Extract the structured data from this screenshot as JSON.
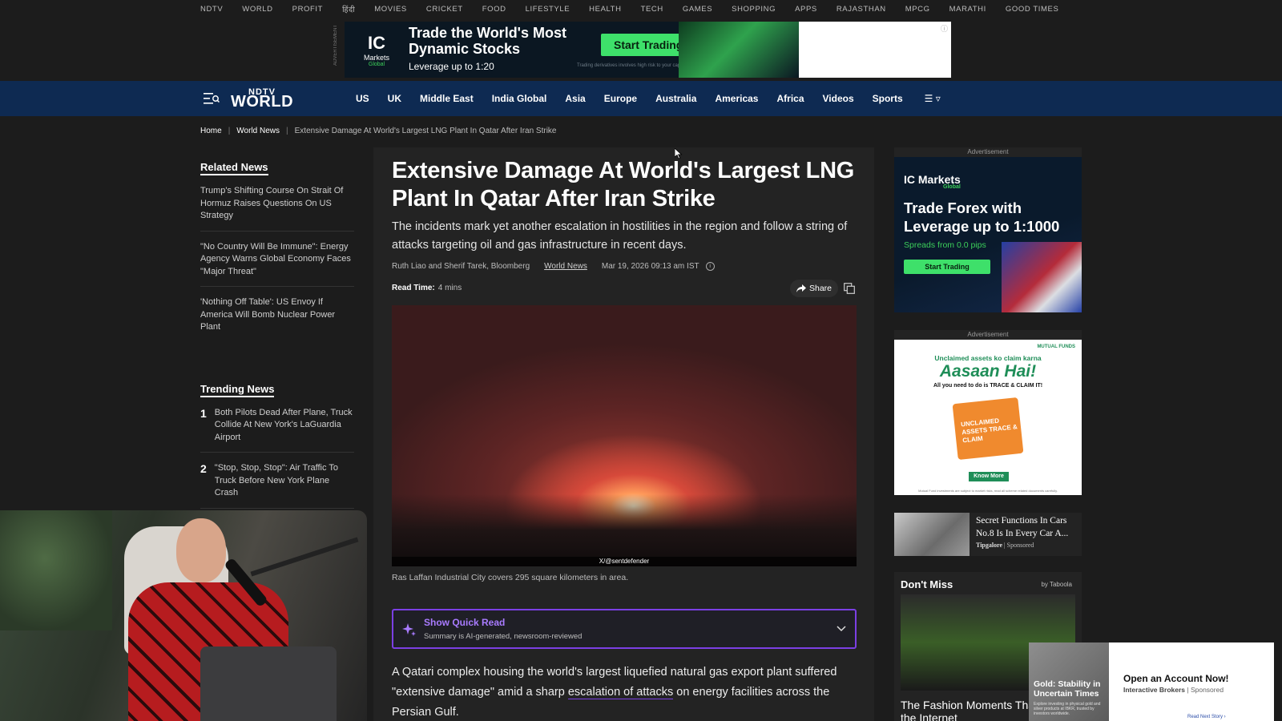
{
  "topbar": {
    "items": [
      "NDTV",
      "WORLD",
      "PROFIT",
      "हिंदी",
      "MOVIES",
      "CRICKET",
      "FOOD",
      "LIFESTYLE",
      "HEALTH",
      "TECH",
      "GAMES",
      "SHOPPING",
      "APPS",
      "RAJASTHAN",
      "MPCG",
      "MARATHI",
      "GOOD TIMES"
    ]
  },
  "top_ad": {
    "label": "ADVERTISEMENT",
    "brand": "IC",
    "brand_sub": "Markets",
    "brand_tag": "Global",
    "headline": "Trade the World's Most Dynamic Stocks",
    "sub": "Leverage up to 1:20",
    "cta": "Start Trading",
    "fine_print": "Trading derivatives involves high risk to your capital"
  },
  "nav": {
    "brand_top": "NDTV",
    "brand_main": "WORLD",
    "links": [
      "US",
      "UK",
      "Middle East",
      "India Global",
      "Asia",
      "Europe",
      "Australia",
      "Americas",
      "Africa",
      "Videos",
      "Sports"
    ],
    "more": "☰ ▿"
  },
  "breadcrumb": {
    "home": "Home",
    "section": "World News",
    "current": "Extensive Damage At World's Largest LNG Plant In Qatar After Iran Strike"
  },
  "related": {
    "title": "Related News",
    "items": [
      "Trump's Shifting Course On Strait Of Hormuz Raises Questions On US Strategy",
      "\"No Country Will Be Immune\": Energy Agency Warns Global Economy Faces \"Major Threat\"",
      "'Nothing Off Table': US Envoy If America Will Bomb Nuclear Power Plant"
    ]
  },
  "trending": {
    "title": "Trending News",
    "items": [
      {
        "num": "1",
        "text": "Both Pilots Dead After Plane, Truck Collide At New York's LaGuardia Airport"
      },
      {
        "num": "2",
        "text": "\"Stop, Stop, Stop\": Air Traffic To Truck Before New York Plane Crash"
      }
    ]
  },
  "article": {
    "title": "Extensive Damage At World's Largest LNG Plant In Qatar After Iran Strike",
    "subtitle": "The incidents mark yet another escalation in hostilities in the region and follow a string of attacks targeting oil and gas infrastructure in recent days.",
    "authors": "Ruth Liao and Sherif Tarek, Bloomberg",
    "category": "World News",
    "date": "Mar 19, 2026 09:13 am IST",
    "read_time_label": "Read Time:",
    "read_time": "4 mins",
    "share_label": "Share",
    "image_credit": "X/@sentdefender",
    "caption": "Ras Laffan Industrial City covers 295 square kilometers in area.",
    "quick_read_title": "Show Quick Read",
    "quick_read_sub": "Summary is AI-generated, newsroom-reviewed",
    "body_before": "A Qatari complex housing the world's largest liquefied natural gas export plant suffered \"extensive damage\" amid a sharp ",
    "body_link": "escalation of attacks",
    "body_after": " on energy facilities across the Persian Gulf."
  },
  "right_ad1": {
    "label": "Advertisement",
    "brand": "IC Markets",
    "brand_tag": "Global",
    "headline": "Trade Forex with Leverage up to 1:1000",
    "spreads": "Spreads from 0.0 pips",
    "cta": "Start Trading"
  },
  "right_ad2": {
    "label": "Advertisement",
    "line1": "Unclaimed assets ko claim karna",
    "line2": "Aasaan Hai!",
    "line3": "All you need to do is TRACE & CLAIM IT!",
    "folder_text": "UNCLAIMED ASSETS TRACE & CLAIM",
    "badge": "MUTUAL FUNDS",
    "cta": "Know More",
    "fine": "Mutual Fund investments are subject to market risks, read all scheme related documents carefully."
  },
  "sponsored": {
    "title": "Secret Functions In Cars No.8 Is In Every Car A...",
    "source": "Tipgalore",
    "tag": "| Sponsored"
  },
  "dont_miss": {
    "title": "Don't Miss",
    "by": "by Taboola",
    "caption": "The Fashion Moments That Broke the Internet"
  },
  "popup": {
    "gold_title": "Gold: Stability in Uncertain Times",
    "gold_fine": "Explore investing in physical gold and silver products at IBKR, trusted by investors worldwide.",
    "title": "Open an Account Now!",
    "brand": "Interactive Brokers",
    "tag": "| Sponsored",
    "read_next": "Read Next Story ›"
  },
  "colors": {
    "nav_bg": "#0e2a52",
    "accent_purple": "#7b3fe4",
    "ad_green": "#3ee06a"
  }
}
